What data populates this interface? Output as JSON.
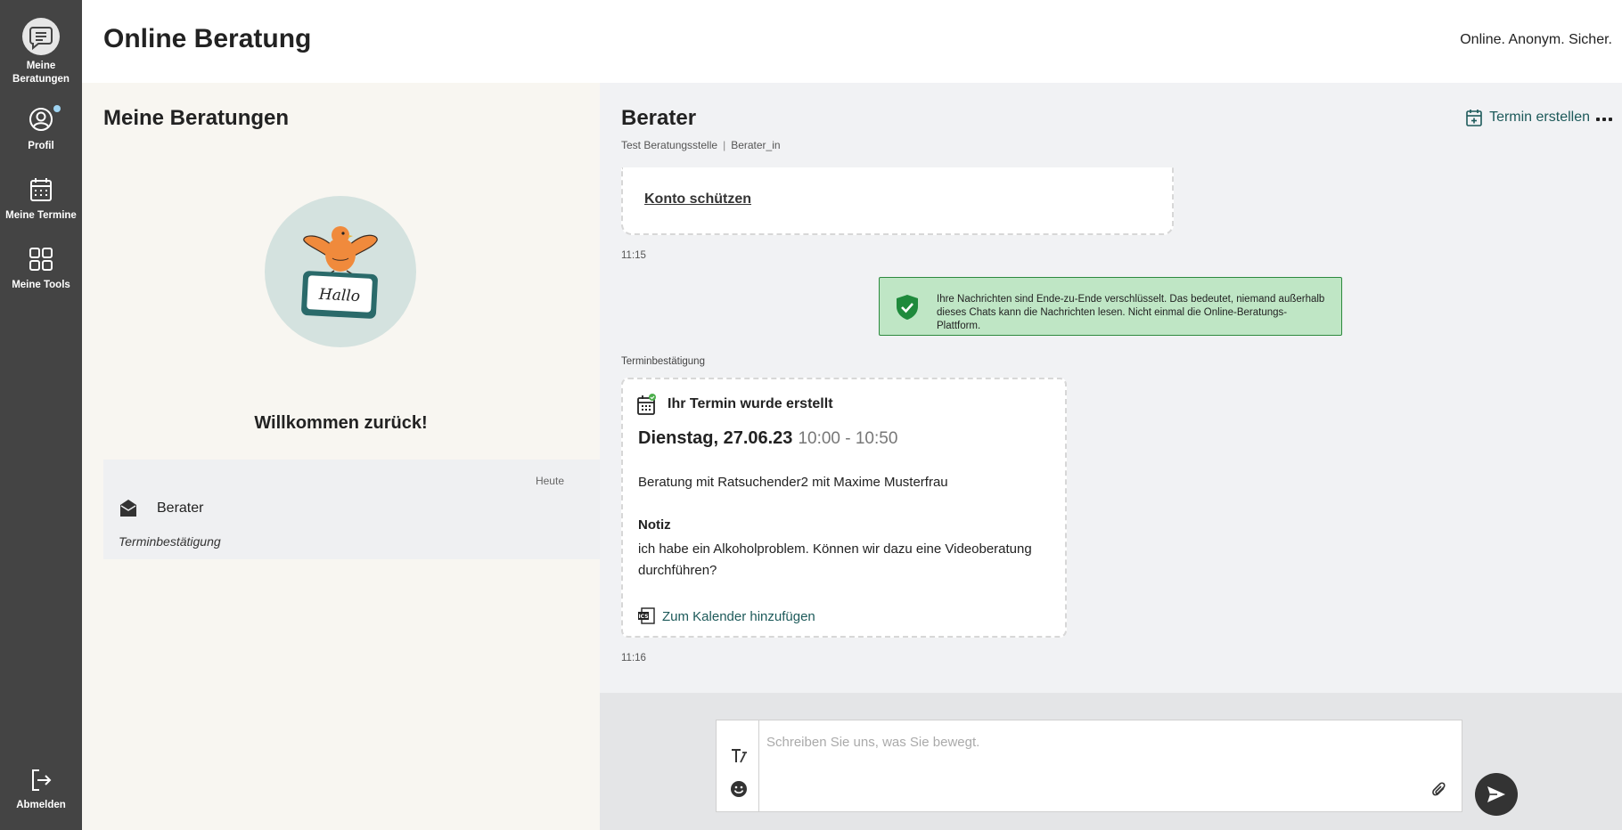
{
  "sidebar": {
    "items": [
      {
        "label": "Meine Beratungen",
        "icon": "chat-bubble-icon",
        "active": true
      },
      {
        "label": "Profil",
        "icon": "user-circle-icon"
      },
      {
        "label": "Meine Termine",
        "icon": "calendar-icon"
      },
      {
        "label": "Meine Tools",
        "icon": "grid-icon"
      }
    ],
    "logout_label": "Abmelden"
  },
  "header": {
    "title": "Online Beratung",
    "tagline": "Online. Anonym. Sicher."
  },
  "left_panel": {
    "title": "Meine Beratungen",
    "illustration_text": "Hallo",
    "welcome": "Willkommen zurück!",
    "sessions": [
      {
        "name": "Berater",
        "date": "Heute",
        "subject": "Terminbestätigung"
      }
    ]
  },
  "chat": {
    "title": "Berater",
    "agency": "Test Beratungsstelle",
    "separator": "|",
    "role": "Berater_in",
    "create_appointment_label": "Termin erstellen",
    "messages": {
      "protect_link": "Konto schützen",
      "time_1": "11:15",
      "e2e_notice": "Ihre Nachrichten sind Ende-zu-Ende verschlüsselt. Das bedeutet, niemand außerhalb dieses Chats kann die Nachrichten lesen. Nicht einmal die Online-Beratungs-Plattform.",
      "appointment_label": "Terminbestätigung",
      "appointment": {
        "heading": "Ihr Termin wurde erstellt",
        "date": "Dienstag, 27.06.23",
        "time": "10:00 - 10:50",
        "description": "Beratung mit Ratsuchender2 mit Maxime Musterfrau",
        "note_label": "Notiz",
        "note": "ich habe ein Alkoholproblem. Können wir dazu eine Videoberatung durchführen?",
        "calendar_link": "Zum Kalender hinzufügen"
      },
      "time_2": "11:16"
    }
  },
  "composer": {
    "placeholder": "Schreiben Sie uns, was Sie bewegt.",
    "value": ""
  },
  "colors": {
    "sidebar_bg": "#444444",
    "accent_teal": "#1d5a5a",
    "notice_bg": "#bfe6c5",
    "notice_border": "#2d8a3e",
    "bird_orange": "#f08a3c"
  }
}
